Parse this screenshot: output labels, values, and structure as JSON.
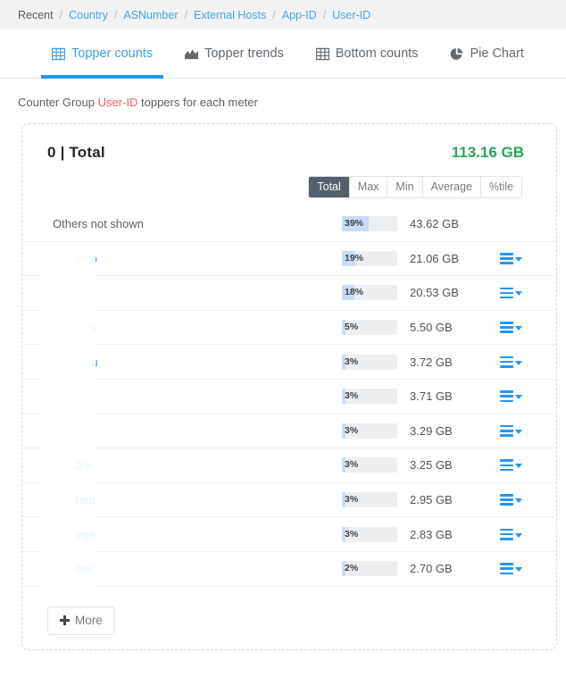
{
  "breadcrumb": {
    "separator": "/",
    "items": [
      {
        "label": "Recent",
        "current": true
      },
      {
        "label": "Country",
        "current": false
      },
      {
        "label": "ASNumber",
        "current": false
      },
      {
        "label": "External Hosts",
        "current": false
      },
      {
        "label": "App-ID",
        "current": false
      },
      {
        "label": "User-ID",
        "current": false
      }
    ]
  },
  "tabs": [
    {
      "label": "Topper counts",
      "icon": "table-grid-icon",
      "active": true
    },
    {
      "label": "Topper trends",
      "icon": "area-chart-icon",
      "active": false
    },
    {
      "label": "Bottom counts",
      "icon": "table-grid-icon",
      "active": false
    },
    {
      "label": "Pie Chart",
      "icon": "pie-chart-icon",
      "active": false
    }
  ],
  "subtitle": {
    "prefix": "Counter Group ",
    "highlight": "User-ID",
    "suffix": " toppers for each meter",
    "highlight_color": "#f4625f"
  },
  "card": {
    "title": "0 | Total",
    "total": "113.16 GB",
    "total_color": "#26a65b",
    "stats": [
      {
        "label": "Total",
        "active": true
      },
      {
        "label": "Max",
        "active": false
      },
      {
        "label": "Min",
        "active": false
      },
      {
        "label": "Average",
        "active": false
      },
      {
        "label": "%tile",
        "active": false
      }
    ],
    "more_label": "More",
    "more_icon": "plus-icon",
    "menu_icon": "hamburger-icon",
    "caret_icon": "caret-down-icon"
  },
  "chart_data": {
    "type": "bar",
    "title": "0 | Total",
    "total": "113.16 GB",
    "unit": "GB",
    "xlabel": "",
    "ylabel": "",
    "categories": [
      "Others not shown",
      "woo",
      "vc.",
      "ada",
      "glau",
      "bal",
      "cot",
      "a\\v-",
      "hep",
      "ege",
      "our"
    ],
    "values": [
      43.62,
      21.06,
      20.53,
      5.5,
      3.72,
      3.71,
      3.29,
      3.25,
      2.95,
      2.83,
      2.7
    ],
    "percents": [
      39,
      19,
      18,
      5,
      3,
      3,
      3,
      3,
      3,
      3,
      2
    ],
    "value_labels": [
      "43.62 GB",
      "21.06 GB",
      "20.53 GB",
      "5.50 GB",
      "3.72 GB",
      "3.71 GB",
      "3.29 GB",
      "3.25 GB",
      "2.95 GB",
      "2.83 GB",
      "2.70 GB"
    ],
    "percent_labels": [
      "39%",
      "19%",
      "18%",
      "5%",
      "3%",
      "3%",
      "3%",
      "3%",
      "3%",
      "3%",
      "2%"
    ],
    "rows": [
      {
        "label": "Others not shown",
        "percent": 39,
        "percent_label": "39%",
        "value_label": "43.62 GB",
        "summary": true,
        "menu": false
      },
      {
        "label": "woo",
        "percent": 19,
        "percent_label": "19%",
        "value_label": "21.06 GB",
        "summary": false,
        "menu": true
      },
      {
        "label": "vc.",
        "percent": 18,
        "percent_label": "18%",
        "value_label": "20.53 GB",
        "summary": false,
        "menu": true
      },
      {
        "label": "ada",
        "percent": 5,
        "percent_label": "5%",
        "value_label": "5.50 GB",
        "summary": false,
        "menu": true
      },
      {
        "label": "glau",
        "percent": 3,
        "percent_label": "3%",
        "value_label": "3.72 GB",
        "summary": false,
        "menu": true
      },
      {
        "label": "bal",
        "percent": 3,
        "percent_label": "3%",
        "value_label": "3.71 GB",
        "summary": false,
        "menu": true
      },
      {
        "label": "cot",
        "percent": 3,
        "percent_label": "3%",
        "value_label": "3.29 GB",
        "summary": false,
        "menu": true
      },
      {
        "label": "a\\v-",
        "percent": 3,
        "percent_label": "3%",
        "value_label": "3.25 GB",
        "summary": false,
        "menu": true
      },
      {
        "label": "hep",
        "percent": 3,
        "percent_label": "3%",
        "value_label": "2.95 GB",
        "summary": false,
        "menu": true
      },
      {
        "label": "ege",
        "percent": 3,
        "percent_label": "3%",
        "value_label": "2.83 GB",
        "summary": false,
        "menu": true
      },
      {
        "label": "our",
        "percent": 2,
        "percent_label": "2%",
        "value_label": "2.70 GB",
        "summary": false,
        "menu": true
      }
    ],
    "bar_track_color": "#eceef0",
    "bar_fill_color": "#c9dcf6",
    "legend": [],
    "grid": false
  }
}
